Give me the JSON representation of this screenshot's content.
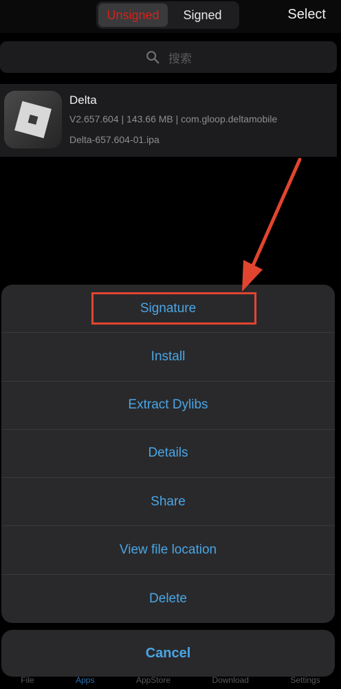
{
  "header": {
    "segments": [
      {
        "label": "Unsigned",
        "active": true
      },
      {
        "label": "Signed",
        "active": false
      }
    ],
    "select_label": "Select"
  },
  "search": {
    "placeholder": "搜索",
    "icon": "search-icon"
  },
  "app": {
    "name": "Delta",
    "meta": "V2.657.604 | 143.66 MB | com.gloop.deltamobile",
    "file": "Delta-657.604-01.ipa",
    "icon": "roblox-logo-icon"
  },
  "action_sheet": {
    "items": [
      "Signature",
      "Install",
      "Extract Dylibs",
      "Details",
      "Share",
      "View file location",
      "Delete"
    ],
    "cancel_label": "Cancel"
  },
  "tabbar": {
    "items": [
      "File",
      "Apps",
      "AppStore",
      "Download",
      "Settings"
    ]
  },
  "colors": {
    "accent": "#4aa6e6",
    "active_segment_text": "#d0231b",
    "annotation": "#e2452f",
    "sheet_bg": "#29292b"
  }
}
